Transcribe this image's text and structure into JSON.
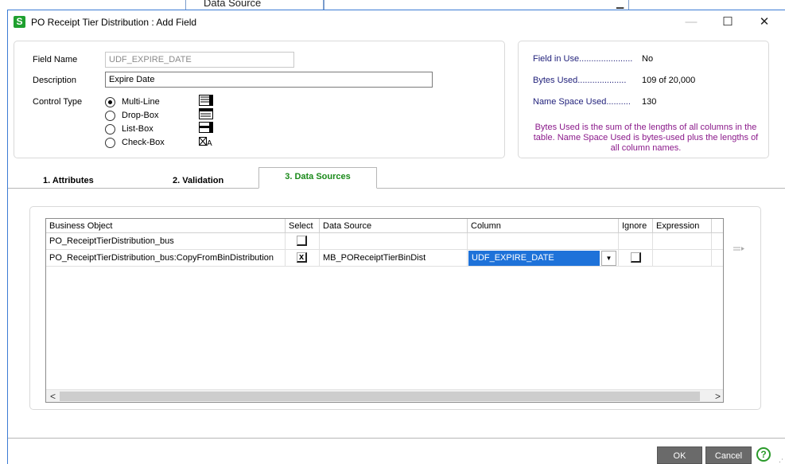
{
  "background_window": {
    "label": "Data Source"
  },
  "window": {
    "title": "PO Receipt Tier Distribution : Add Field",
    "app_icon_letter": "S",
    "minimize": "—",
    "maximize": "☐",
    "close": "✕"
  },
  "form": {
    "field_name_label": "Field Name",
    "field_name_value": "UDF_EXPIRE_DATE",
    "description_label": "Description",
    "description_value": "Expire Date",
    "control_type_label": "Control Type",
    "control_types": [
      {
        "label": "Multi-Line",
        "selected": true,
        "icon": "multiline-icon"
      },
      {
        "label": "Drop-Box",
        "selected": false,
        "icon": "dropbox-icon"
      },
      {
        "label": "List-Box",
        "selected": false,
        "icon": "listbox-icon"
      },
      {
        "label": "Check-Box",
        "selected": false,
        "icon": "checkbox-icon"
      }
    ]
  },
  "info": {
    "field_in_use_label": "Field in Use......................",
    "field_in_use_value": "No",
    "bytes_used_label": "Bytes Used....................",
    "bytes_used_value": "109 of 20,000",
    "name_space_label": "Name Space Used..........",
    "name_space_value": "130",
    "note": "Bytes Used is the sum of the lengths of all columns in the table.  Name Space Used is bytes-used plus the lengths of all column names."
  },
  "tabs": [
    {
      "label": "1. Attributes",
      "active": false
    },
    {
      "label": "2. Validation",
      "active": false
    },
    {
      "label": "3. Data Sources",
      "active": true
    }
  ],
  "grid": {
    "headers": [
      "Business Object",
      "Select",
      "Data Source",
      "Column",
      "Ignore",
      "Expression"
    ],
    "rows": [
      {
        "business_object": "PO_ReceiptTierDistribution_bus",
        "select": false,
        "data_source": "",
        "column": "",
        "ignore": null
      },
      {
        "business_object": "PO_ReceiptTierDistribution_bus:CopyFromBinDistribution",
        "select": true,
        "data_source": "MB_POReceiptTierBinDist",
        "column": "UDF_EXPIRE_DATE",
        "ignore": false
      }
    ],
    "check_mark": "x",
    "dropdown_arrow": "▼",
    "scroll_left": "<",
    "scroll_right": ">"
  },
  "buttons": {
    "ok": "OK",
    "cancel": "Cancel",
    "help": "?"
  },
  "colors": {
    "accent_green": "#1fa02f",
    "selection_blue": "#1e72d9",
    "info_text": "#1f1f7a",
    "note_text": "#8b1a8b"
  }
}
